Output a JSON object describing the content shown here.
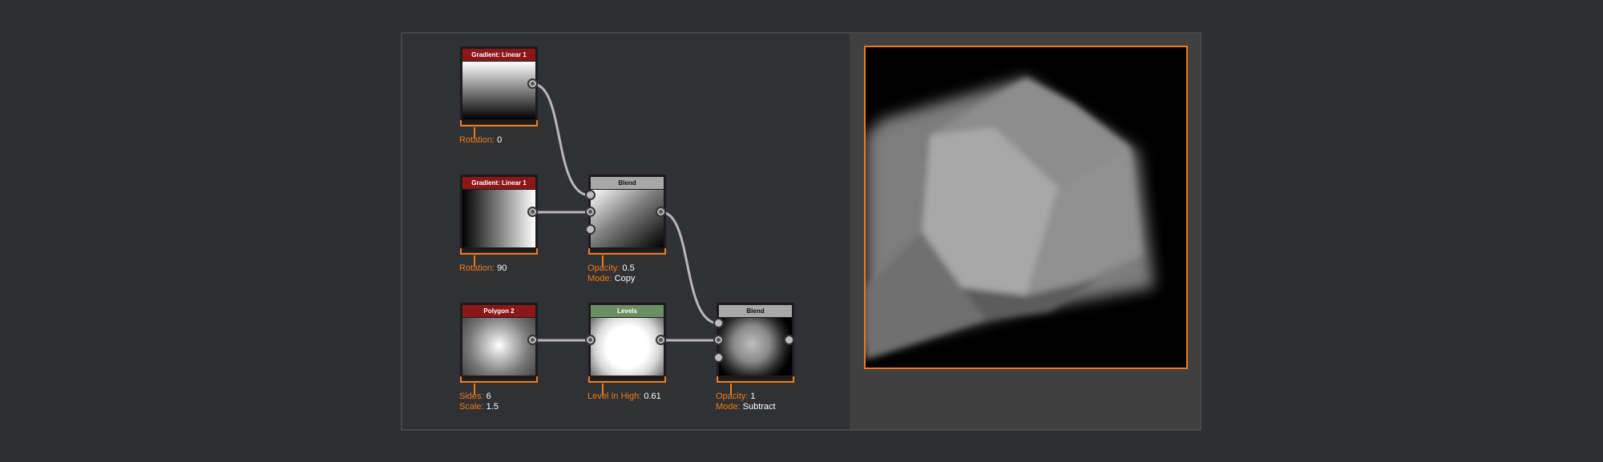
{
  "nodes": {
    "gradient1": {
      "title": "Gradient: Linear 1",
      "params": [
        {
          "label": "Rotation: ",
          "value": "0"
        }
      ]
    },
    "gradient2": {
      "title": "Gradient: Linear 1",
      "params": [
        {
          "label": "Rotation: ",
          "value": "90"
        }
      ]
    },
    "blend1": {
      "title": "Blend",
      "params": [
        {
          "label": "Opacity: ",
          "value": "0.5"
        },
        {
          "label": "Mode: ",
          "value": "Copy"
        }
      ]
    },
    "polygon": {
      "title": "Polygon 2",
      "params": [
        {
          "label": "Sides: ",
          "value": "6"
        },
        {
          "label": "Scale: ",
          "value": "1.5"
        }
      ]
    },
    "levels": {
      "title": "Levels",
      "params": [
        {
          "label": "Level In High: ",
          "value": "0.61"
        }
      ]
    },
    "blend2": {
      "title": "Blend",
      "params": [
        {
          "label": "Opacity: ",
          "value": "1"
        },
        {
          "label": "Mode: ",
          "value": "Subtract"
        }
      ]
    }
  },
  "colors": {
    "accent": "#f07a17",
    "node_title_red": "#8b1719",
    "node_title_gray": "#a8a8a8",
    "node_title_green": "#6b8f63",
    "wire": "#b8b8b8"
  }
}
